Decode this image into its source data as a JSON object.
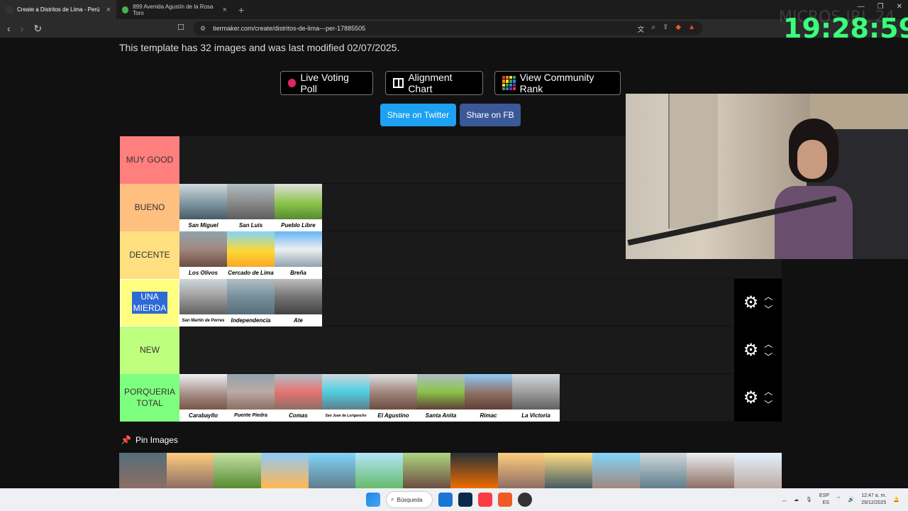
{
  "browser": {
    "tabs": [
      {
        "title": "Create a Distritos de Lima - Perú",
        "active": true
      },
      {
        "title": "899 Avenida Agustín de la Rosa Toro",
        "active": false
      }
    ],
    "url": "tiermaker.com/create/distritos-de-lima---per-17885505"
  },
  "overlay": {
    "clock": "19:28:59",
    "watermark": "MICROS IRL 24"
  },
  "page": {
    "template_info": "This template has 32 images and was last modified 02/07/2025.",
    "buttons": {
      "live_voting": "Live Voting Poll",
      "alignment": "Alignment Chart",
      "community": "View Community Rank",
      "share_twitter": "Share on Twitter",
      "share_fb": "Share on FB"
    },
    "tiers": [
      {
        "label": "MUY GOOD",
        "color": "#ff7f7f",
        "items": []
      },
      {
        "label": "BUENO",
        "color": "#ffbf7f",
        "items": [
          "San Miguel",
          "San Luis",
          "Pueblo Libre"
        ]
      },
      {
        "label": "DECENTE",
        "color": "#ffdf7f",
        "items": [
          "Los Olivos",
          "Cercado de Lima",
          "Breña"
        ]
      },
      {
        "label": "UNA MIERDA",
        "color": "#ffff7f",
        "items": [
          "San Martín de Porres",
          "Independencia",
          "Ate"
        ]
      },
      {
        "label": "NEW",
        "color": "#bfff7f",
        "items": []
      },
      {
        "label": "PORQUERIA TOTAL",
        "color": "#7fff7f",
        "items": [
          "Carabayllo",
          "Puente Piedra",
          "Comas",
          "San Juan de Lurigancho",
          "El Agustino",
          "Santa Anita",
          "Rimac",
          "La Victoria"
        ]
      }
    ],
    "pin_images": "Pin Images"
  },
  "taskbar": {
    "search": "Búsqueda",
    "lang": "ESP",
    "lang2": "ES",
    "time": "12:47 a. m.",
    "date": "29/12/2025"
  }
}
